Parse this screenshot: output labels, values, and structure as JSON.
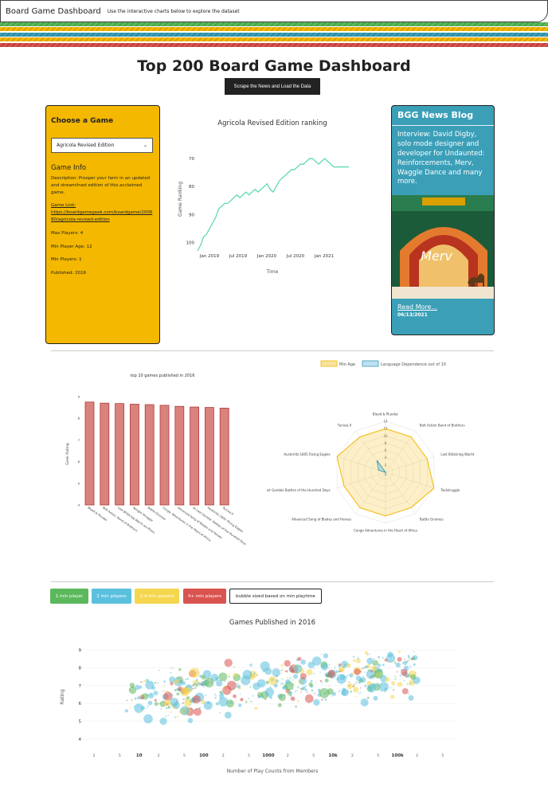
{
  "topbar": {
    "brand": "Board Game Dashboard",
    "subtitle": "Use the interactive charts below to explore the dataset"
  },
  "page": {
    "title": "Top 200 Board Game Dashboard",
    "scrape_button": "Scrape the News and Load the Data"
  },
  "colors": {
    "yellow": "#f4b800",
    "teal": "#3b9fb8",
    "red": "#d9534f",
    "green": "#5cb85c",
    "light_blue": "#5bc0de",
    "light_yellow": "#f5d64e",
    "stripe_colors": [
      "#5cb85c",
      "#f4b800",
      "#3b9fb8",
      "#d9534f"
    ]
  },
  "chooser": {
    "heading": "Choose a Game",
    "selected": "Agricola Revised Edition",
    "info_heading": "Game Info",
    "description": "Description: Prosper your farm in an updated and streamlined edition of this acclaimed game.",
    "link_label": "Game Link:",
    "link_url": "https://boardgamegeek.com/boardgame/200680/agricola-revised-edition",
    "max_players": "Max Players: 4",
    "min_age": "Min Player Age: 12",
    "min_players": "Min Players: 1",
    "published": "Published: 2016"
  },
  "news": {
    "heading": "BGG News Blog",
    "headline": "Interview: David Digby, solo mode designer and developer for Undaunted: Reinforcements, Merv, Waggle Dance and many more.",
    "image_title": "Merv",
    "read_more": "Read More...",
    "date": "06/13/2021"
  },
  "legend_buttons": [
    "1 min player",
    "2 min players",
    "3-4 min players",
    "4+ min players",
    "bubble sized based on min playtime"
  ],
  "chart_data": [
    {
      "type": "line",
      "title": "Agricola Revised Edition ranking",
      "xlabel": "Time",
      "ylabel": "Game Ranking",
      "x_ticks": [
        "Jan 2019",
        "Jul 2019",
        "Jan 2020",
        "Jul 2020",
        "Jan 2021"
      ],
      "y_ticks": [
        70,
        80,
        90,
        100
      ],
      "ylim": [
        103,
        66
      ],
      "x": [
        0,
        0.02,
        0.04,
        0.06,
        0.08,
        0.1,
        0.12,
        0.14,
        0.16,
        0.18,
        0.2,
        0.22,
        0.24,
        0.26,
        0.28,
        0.3,
        0.32,
        0.34,
        0.36,
        0.38,
        0.4,
        0.42,
        0.44,
        0.46,
        0.48,
        0.5,
        0.52,
        0.54,
        0.56,
        0.58,
        0.6,
        0.62,
        0.64,
        0.66,
        0.68,
        0.7,
        0.72,
        0.74,
        0.76,
        0.78,
        0.8,
        0.82,
        0.84,
        0.86,
        0.88,
        0.9,
        0.92,
        0.94,
        0.96,
        1.0
      ],
      "values": [
        103,
        101,
        98,
        97,
        95,
        93,
        91,
        88,
        87,
        86,
        86,
        85,
        84,
        83,
        84,
        83,
        82,
        83,
        82,
        81,
        82,
        81,
        80,
        79,
        81,
        82,
        80,
        78,
        77,
        76,
        75,
        74,
        74,
        73,
        72,
        72,
        71,
        70,
        70,
        71,
        72,
        71,
        70,
        71,
        72,
        73,
        73,
        73,
        73,
        73
      ]
    },
    {
      "type": "bar",
      "title": "top 10 games published in 2016",
      "ylabel": "Geek Rating",
      "categories": [
        "Blood & Plunder",
        "Bolt Action: Band of Brothers",
        "Last Blitzkrieg Wacht am Rhein",
        "Twilight Struggle",
        "Battle Gnomes",
        "Congo: Adventures in the Heart of Africa",
        "Advanced Song of Blades and Heroes",
        "Vs Last Gamble: Battles of the Hundred Days",
        "Austerlitz 1805: Rising Eagles",
        "Tunisia II"
      ],
      "values": [
        8.75,
        8.7,
        8.68,
        8.65,
        8.63,
        8.6,
        8.55,
        8.52,
        8.5,
        8.47
      ],
      "ylim": [
        4,
        9
      ]
    },
    {
      "type": "radar",
      "legend": [
        "Min Age",
        "Language Dependence out of 10"
      ],
      "categories": [
        "Blood & Plunder",
        "Bolt Action Band of Brothers",
        "Last Blitzkrieg Wacht",
        "Twilstruggle",
        "Battle Gnomes",
        "Congo Adventures in the Heart of Africa",
        "Advanced Song of Blades and Heroes",
        "Vs Last Gamble Battles of the Hundred Days",
        "Austerlitz 1805 Rising Eagles",
        "Tunisia II"
      ],
      "series": [
        {
          "name": "Min Age",
          "values": [
            12,
            12,
            12,
            14,
            12,
            12,
            12,
            12,
            14,
            12
          ]
        },
        {
          "name": "Language Dependence out of 10",
          "values": [
            0,
            0,
            0,
            0,
            0,
            1,
            0,
            0,
            2,
            4
          ]
        }
      ],
      "r_ticks": [
        2,
        4,
        6,
        8,
        10,
        12,
        14
      ]
    },
    {
      "type": "scatter",
      "title": "Games Published in 2016",
      "xlabel": "Number of Play Counts from Members",
      "ylabel": "Rating",
      "x_scale": "log",
      "x_ticks": [
        "10",
        "100",
        "1000",
        "10k",
        "100k"
      ],
      "y_ticks": [
        4,
        5,
        6,
        7,
        8,
        9
      ]
    }
  ]
}
